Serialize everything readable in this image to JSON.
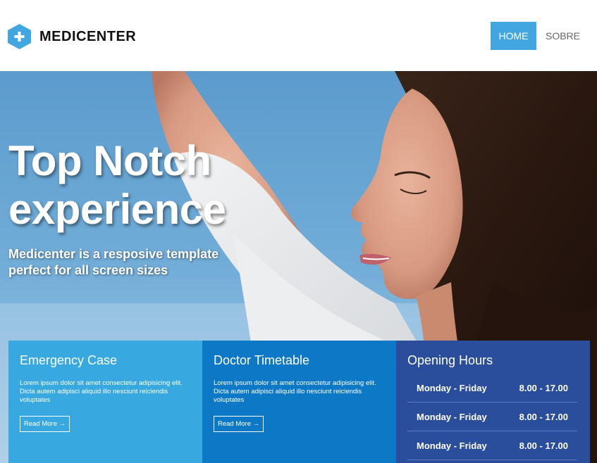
{
  "header": {
    "brand": "MEDICENTER",
    "nav": [
      {
        "label": "HOME",
        "active": true
      },
      {
        "label": "SOBRE",
        "active": false
      }
    ]
  },
  "hero": {
    "title_line1": "Top Notch",
    "title_line2": "experience",
    "subtitle_line1": "Medicenter is a resposive template",
    "subtitle_line2": "perfect for all screen sizes"
  },
  "cards": {
    "emergency": {
      "title": "Emergency Case",
      "text": "Lorem ipsum dolor sit amet consectetur adipisicing elit. Dicta autem adipisci aliquid illo nesciunt reiciendis voluptates",
      "button": "Read More →"
    },
    "timetable": {
      "title": "Doctor Timetable",
      "text": "Lorem ipsum dolor sit amet consectetur adipisicing elit. Dicta autem adipisci aliquid illo nesciunt reiciendis voluptates",
      "button": "Read More →"
    },
    "hours": {
      "title": "Opening Hours",
      "rows": [
        {
          "day": "Monday - Friday",
          "time": "8.00 - 17.00"
        },
        {
          "day": "Monday - Friday",
          "time": "8.00 - 17.00"
        },
        {
          "day": "Monday - Friday",
          "time": "8.00 - 17.00"
        }
      ]
    }
  },
  "colors": {
    "accent": "#42a6e1",
    "card_emergency": "#37a8e0",
    "card_timetable": "#0d79c6",
    "card_hours": "#2a4e9b"
  },
  "icons": {
    "logo": "medical-cross-hexagon-icon"
  }
}
